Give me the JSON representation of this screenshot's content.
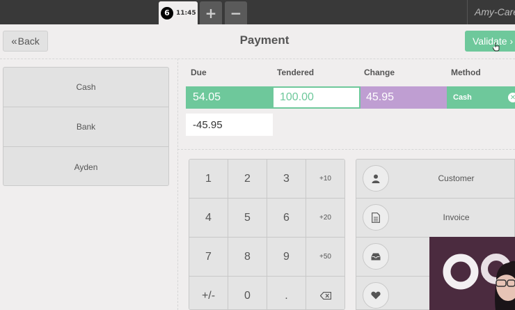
{
  "topbar": {
    "order_number": "6",
    "order_time": "11:45",
    "add_label": "+",
    "remove_label": "−",
    "user_name": "Amy-Care"
  },
  "header": {
    "back_label": "Back",
    "title": "Payment",
    "validate_label": "Validate ›"
  },
  "payment_methods": [
    "Cash",
    "Bank",
    "Ayden"
  ],
  "paymentlines": {
    "headers": {
      "due": "Due",
      "tendered": "Tendered",
      "change": "Change",
      "method": "Method"
    },
    "line": {
      "due": "54.05",
      "tendered": "100.00",
      "change": "45.95",
      "method": "Cash"
    },
    "remaining": "-45.95"
  },
  "numpad": {
    "keys": [
      "1",
      "2",
      "3",
      "+10",
      "4",
      "5",
      "6",
      "+20",
      "7",
      "8",
      "9",
      "+50",
      "+/-",
      "0",
      ".",
      "⌫"
    ]
  },
  "actions": [
    {
      "label": "Customer",
      "icon": "user-icon"
    },
    {
      "label": "Invoice",
      "icon": "file-icon"
    },
    {
      "label": "",
      "icon": "inbox-icon"
    },
    {
      "label": "",
      "icon": "heart-icon"
    }
  ],
  "colors": {
    "accent_green": "#6ec89b",
    "change_purple": "#bf9ed2",
    "topbar": "#393939"
  }
}
